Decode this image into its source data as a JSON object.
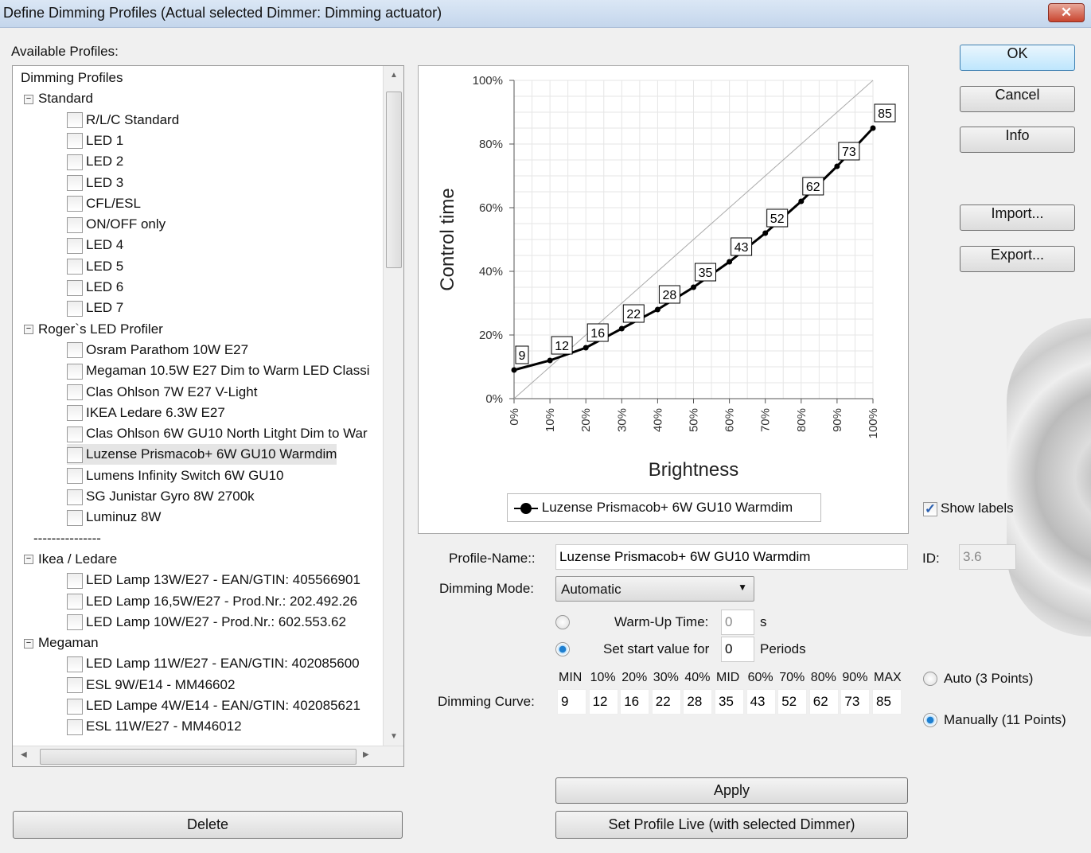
{
  "window": {
    "title": "Define Dimming Profiles (Actual selected Dimmer: Dimming actuator)",
    "close": "✕"
  },
  "available_label": "Available Profiles:",
  "tree": [
    {
      "label": "Dimming Profiles",
      "level": 0,
      "type": "root"
    },
    {
      "label": "Standard",
      "level": 1,
      "type": "group"
    },
    {
      "label": "R/L/C Standard",
      "level": 2,
      "type": "item"
    },
    {
      "label": "LED 1",
      "level": 2,
      "type": "item"
    },
    {
      "label": "LED 2",
      "level": 2,
      "type": "item"
    },
    {
      "label": "LED 3",
      "level": 2,
      "type": "item"
    },
    {
      "label": "CFL/ESL",
      "level": 2,
      "type": "item"
    },
    {
      "label": "ON/OFF only",
      "level": 2,
      "type": "item"
    },
    {
      "label": "LED 4",
      "level": 2,
      "type": "item"
    },
    {
      "label": "LED 5",
      "level": 2,
      "type": "item"
    },
    {
      "label": "LED 6",
      "level": 2,
      "type": "item"
    },
    {
      "label": "LED 7",
      "level": 2,
      "type": "item"
    },
    {
      "label": "Roger`s LED Profiler",
      "level": 1,
      "type": "group"
    },
    {
      "label": "Osram Parathom 10W E27",
      "level": 2,
      "type": "item"
    },
    {
      "label": "Megaman 10.5W E27 Dim to Warm LED Classi",
      "level": 2,
      "type": "item"
    },
    {
      "label": "Clas Ohlson 7W E27 V-Light",
      "level": 2,
      "type": "item"
    },
    {
      "label": "IKEA Ledare 6.3W E27",
      "level": 2,
      "type": "item"
    },
    {
      "label": "Clas Ohlson 6W GU10 North Litght Dim to War",
      "level": 2,
      "type": "item"
    },
    {
      "label": "Luzense Prismacob+ 6W GU10 Warmdim",
      "level": 2,
      "type": "item",
      "selected": true
    },
    {
      "label": "Lumens Infinity Switch 6W GU10",
      "level": 2,
      "type": "item"
    },
    {
      "label": "SG Junistar Gyro 8W 2700k",
      "level": 2,
      "type": "item"
    },
    {
      "label": "Luminuz  8W",
      "level": 2,
      "type": "item"
    },
    {
      "label": "---------------",
      "level": 1,
      "type": "sep"
    },
    {
      "label": "Ikea / Ledare",
      "level": 1,
      "type": "group"
    },
    {
      "label": "LED Lamp 13W/E27 - EAN/GTIN: 405566901",
      "level": 2,
      "type": "item"
    },
    {
      "label": "LED Lamp 16,5W/E27 - Prod.Nr.: 202.492.26",
      "level": 2,
      "type": "item"
    },
    {
      "label": "LED Lamp 10W/E27 - Prod.Nr.: 602.553.62",
      "level": 2,
      "type": "item"
    },
    {
      "label": "Megaman",
      "level": 1,
      "type": "group"
    },
    {
      "label": "LED Lamp 11W/E27 - EAN/GTIN: 402085600",
      "level": 2,
      "type": "item"
    },
    {
      "label": "ESL 9W/E14 - MM46602",
      "level": 2,
      "type": "item"
    },
    {
      "label": "LED Lampe 4W/E14 - EAN/GTIN: 402085621",
      "level": 2,
      "type": "item"
    },
    {
      "label": "ESL 11W/E27 - MM46012",
      "level": 2,
      "type": "item"
    }
  ],
  "buttons": {
    "ok": "OK",
    "cancel": "Cancel",
    "info": "Info",
    "import": "Import...",
    "export": "Export...",
    "delete": "Delete",
    "apply": "Apply",
    "set_live": "Set Profile Live (with selected Dimmer)"
  },
  "chart_data": {
    "type": "line",
    "xlabel": "Brightness",
    "ylabel": "Control time",
    "x": [
      0,
      10,
      20,
      30,
      40,
      50,
      60,
      70,
      80,
      90,
      100
    ],
    "values": [
      9,
      12,
      16,
      22,
      28,
      35,
      43,
      52,
      62,
      73,
      85
    ],
    "reference_line": [
      [
        0,
        0
      ],
      [
        100,
        100
      ]
    ],
    "xlim": [
      0,
      100
    ],
    "ylim": [
      0,
      100
    ],
    "xticks": [
      "0%",
      "10%",
      "20%",
      "30%",
      "40%",
      "50%",
      "60%",
      "70%",
      "80%",
      "90%",
      "100%"
    ],
    "yticks": [
      "0%",
      "20%",
      "40%",
      "60%",
      "80%",
      "100%"
    ],
    "grid": true,
    "data_labels": true,
    "series": [
      {
        "name": "Luzense Prismacob+ 6W GU10 Warmdim",
        "color": "#000000"
      }
    ],
    "legend_placement": "bottom"
  },
  "show_labels": {
    "label": "Show labels",
    "checked": true
  },
  "form": {
    "profile_name_label": "Profile-Name::",
    "profile_name": "Luzense Prismacob+ 6W GU10 Warmdim",
    "id_label": "ID:",
    "id": "3.6",
    "mode_label": "Dimming Mode:",
    "mode": "Automatic",
    "warmup_label": "Warm-Up Time:",
    "warmup": "0",
    "warmup_unit": "s",
    "start_label": "Set start value for",
    "start": "0",
    "start_unit": "Periods",
    "curve_label": "Dimming Curve:",
    "curve_headers": [
      "MIN",
      "10%",
      "20%",
      "30%",
      "40%",
      "MID",
      "60%",
      "70%",
      "80%",
      "90%",
      "MAX"
    ],
    "curve_values": [
      "9",
      "12",
      "16",
      "22",
      "28",
      "35",
      "43",
      "52",
      "62",
      "73",
      "85"
    ],
    "auto_label": "Auto (3 Points)",
    "manual_label": "Manually (11 Points)"
  }
}
